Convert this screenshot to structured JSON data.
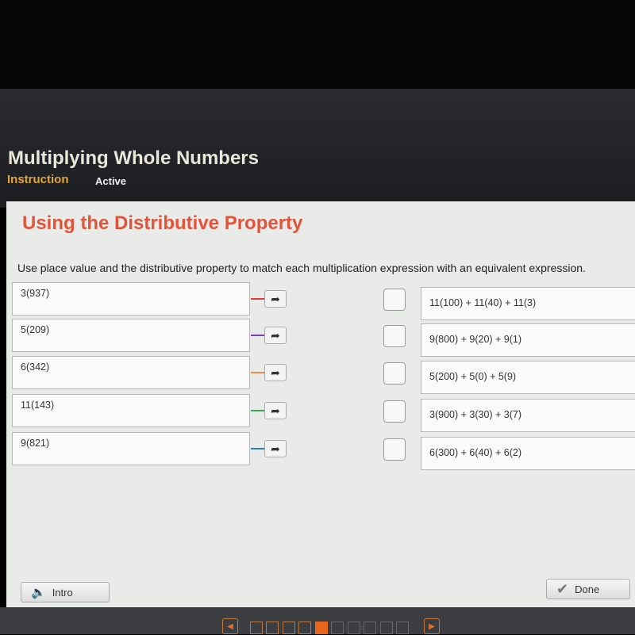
{
  "header": {
    "title": "Multiplying Whole Numbers",
    "tabs": [
      {
        "label": "Instruction",
        "active": true
      },
      {
        "label": "Active",
        "active": false
      }
    ]
  },
  "content": {
    "heading": "Using the Distributive Property",
    "instruction": "Use place value and the distributive property to match each multiplication expression with an equivalent expression.",
    "left_items": [
      {
        "label": "3(937)",
        "color": "#e0393e"
      },
      {
        "label": "5(209)",
        "color": "#7a3fb0"
      },
      {
        "label": "6(342)",
        "color": "#f08a4b"
      },
      {
        "label": "11(143)",
        "color": "#3aa657"
      },
      {
        "label": "9(821)",
        "color": "#2a7fc0"
      }
    ],
    "right_items": [
      {
        "label": "11(100) + 11(40) + 11(3)"
      },
      {
        "label": "9(800) + 9(20) + 9(1)"
      },
      {
        "label": "5(200) + 5(0) + 5(9)"
      },
      {
        "label": "3(900) + 3(30) + 3(7)"
      },
      {
        "label": "6(300) + 6(40) + 6(2)"
      }
    ]
  },
  "footer": {
    "intro_label": "Intro",
    "done_label": "Done"
  },
  "pagination": {
    "total": 10,
    "current": 5,
    "accent": "#e8661e"
  },
  "icons": {
    "arrow": "share-arrow-icon",
    "speaker": "speaker-icon",
    "check": "checkmark-icon"
  }
}
